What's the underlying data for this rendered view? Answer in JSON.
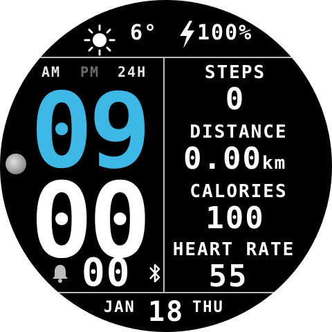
{
  "weather": {
    "icon": "sun-icon",
    "temperature": "6°"
  },
  "battery": {
    "icon": "bolt-icon",
    "percent": "100%"
  },
  "time_format": {
    "am": "AM",
    "pm": "PM",
    "h24": "24H",
    "active_color": "#e6e6e6",
    "inactive_color": "#6b6b6b"
  },
  "time": {
    "hours": "09",
    "minutes": "00",
    "seconds": "00",
    "hour_color": "#3cb7e6",
    "minute_color": "#ffffff"
  },
  "icons": {
    "moon": "moon-icon",
    "alarm": "bell-icon",
    "bluetooth": "bluetooth-icon"
  },
  "stats": {
    "steps": {
      "label": "STEPS",
      "value": "0"
    },
    "distance": {
      "label": "DISTANCE",
      "value": "0.00",
      "unit": "km"
    },
    "calories": {
      "label": "CALORIES",
      "value": "100"
    },
    "heart_rate": {
      "label": "HEART RATE",
      "value": "55"
    }
  },
  "date": {
    "month": "JAN",
    "day": "18",
    "weekday": "THU"
  }
}
